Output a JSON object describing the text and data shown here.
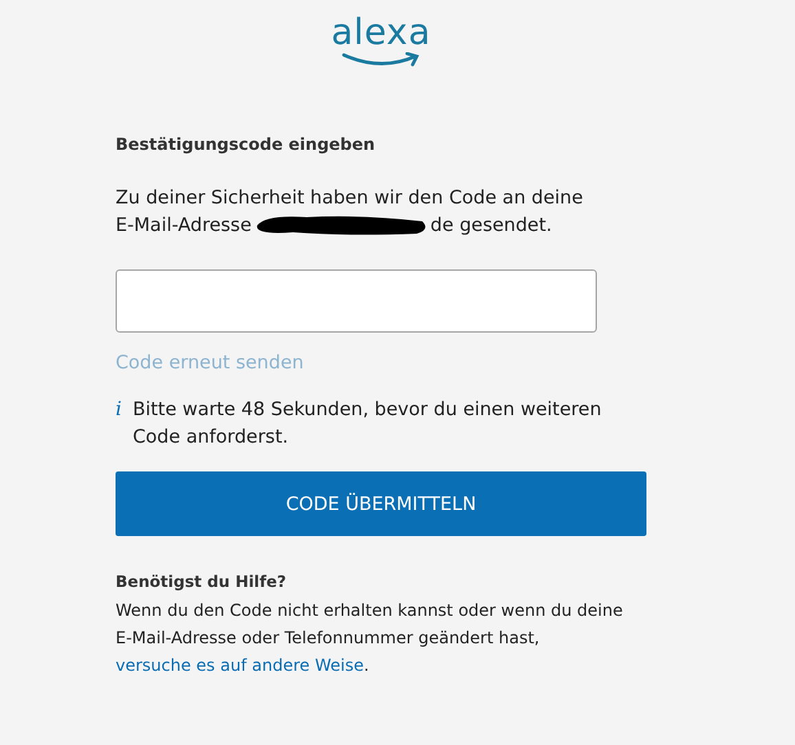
{
  "logo": {
    "text": "alexa"
  },
  "heading": "Bestätigungscode eingeben",
  "message": {
    "line_1": "Zu deiner Sicherheit haben wir den Code an deine",
    "line_2_start": "E-Mail-Adresse",
    "redacted": true,
    "line_2_end": "de gesendet."
  },
  "resend_link": {
    "text": "Code erneut senden",
    "disabled": true
  },
  "notice": {
    "icon": "i",
    "text": "Bitte warte 48 Sekunden, bevor du einen weiteren Code anforderst."
  },
  "submit_button": "CODE ÜBERMITTELN",
  "help": {
    "title": "Benötigst du Hilfe?",
    "text": "Wenn du den Code nicht erhalten kannst oder wenn du deine E-Mail-Adresse oder Telefonnummer geändert hast,",
    "link": "versuche es auf andere Weise",
    "end": "."
  }
}
